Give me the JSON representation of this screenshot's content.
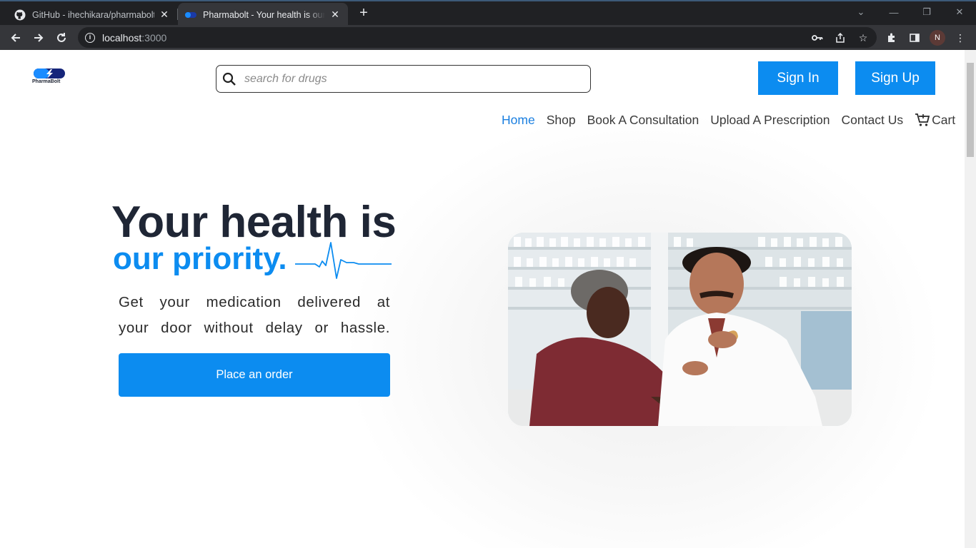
{
  "browser": {
    "tabs": [
      {
        "title": "GitHub - ihechikara/pharmabolt",
        "active": false
      },
      {
        "title": "Pharmabolt - Your health is our priority",
        "active": true
      }
    ],
    "url_host": "localhost",
    "url_port": ":3000",
    "profile_initial": "N"
  },
  "header": {
    "logo_text": "PharmaBolt",
    "search_placeholder": "search for drugs",
    "signin_label": "Sign In",
    "signup_label": "Sign Up"
  },
  "nav": {
    "items": [
      "Home",
      "Shop",
      "Book A Consultation",
      "Upload A Prescription",
      "Contact Us"
    ],
    "active": "Home",
    "cart_label": "Cart"
  },
  "hero": {
    "headline_line1": "Your health is",
    "headline_line2": "our priority.",
    "subtext": "Get your medication delivered at your door without delay or hassle.",
    "cta_label": "Place an order",
    "image_alt": "Pharmacist showing a pill bottle to an elderly customer"
  },
  "colors": {
    "brand_blue": "#0c8cf0",
    "heading_dark": "#1f2635",
    "nav_active": "#1a7fe0"
  }
}
